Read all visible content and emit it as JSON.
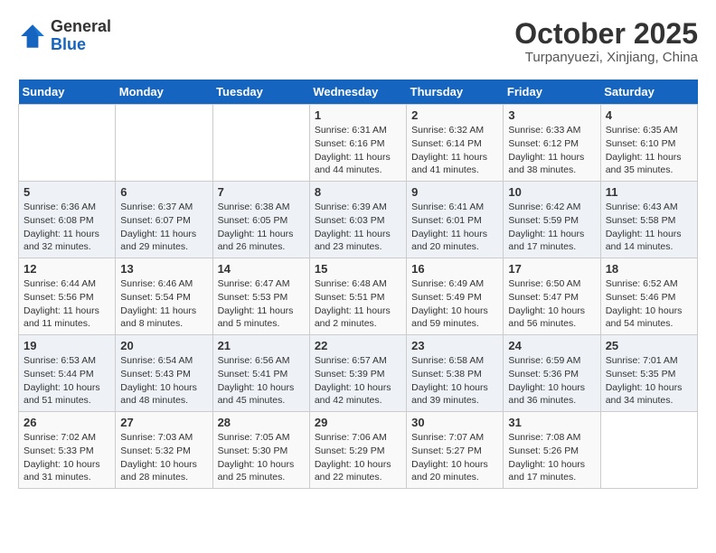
{
  "header": {
    "logo_line1": "General",
    "logo_line2": "Blue",
    "month": "October 2025",
    "location": "Turpanyuezi, Xinjiang, China"
  },
  "weekdays": [
    "Sunday",
    "Monday",
    "Tuesday",
    "Wednesday",
    "Thursday",
    "Friday",
    "Saturday"
  ],
  "weeks": [
    [
      {
        "day": "",
        "info": ""
      },
      {
        "day": "",
        "info": ""
      },
      {
        "day": "",
        "info": ""
      },
      {
        "day": "1",
        "info": "Sunrise: 6:31 AM\nSunset: 6:16 PM\nDaylight: 11 hours\nand 44 minutes."
      },
      {
        "day": "2",
        "info": "Sunrise: 6:32 AM\nSunset: 6:14 PM\nDaylight: 11 hours\nand 41 minutes."
      },
      {
        "day": "3",
        "info": "Sunrise: 6:33 AM\nSunset: 6:12 PM\nDaylight: 11 hours\nand 38 minutes."
      },
      {
        "day": "4",
        "info": "Sunrise: 6:35 AM\nSunset: 6:10 PM\nDaylight: 11 hours\nand 35 minutes."
      }
    ],
    [
      {
        "day": "5",
        "info": "Sunrise: 6:36 AM\nSunset: 6:08 PM\nDaylight: 11 hours\nand 32 minutes."
      },
      {
        "day": "6",
        "info": "Sunrise: 6:37 AM\nSunset: 6:07 PM\nDaylight: 11 hours\nand 29 minutes."
      },
      {
        "day": "7",
        "info": "Sunrise: 6:38 AM\nSunset: 6:05 PM\nDaylight: 11 hours\nand 26 minutes."
      },
      {
        "day": "8",
        "info": "Sunrise: 6:39 AM\nSunset: 6:03 PM\nDaylight: 11 hours\nand 23 minutes."
      },
      {
        "day": "9",
        "info": "Sunrise: 6:41 AM\nSunset: 6:01 PM\nDaylight: 11 hours\nand 20 minutes."
      },
      {
        "day": "10",
        "info": "Sunrise: 6:42 AM\nSunset: 5:59 PM\nDaylight: 11 hours\nand 17 minutes."
      },
      {
        "day": "11",
        "info": "Sunrise: 6:43 AM\nSunset: 5:58 PM\nDaylight: 11 hours\nand 14 minutes."
      }
    ],
    [
      {
        "day": "12",
        "info": "Sunrise: 6:44 AM\nSunset: 5:56 PM\nDaylight: 11 hours\nand 11 minutes."
      },
      {
        "day": "13",
        "info": "Sunrise: 6:46 AM\nSunset: 5:54 PM\nDaylight: 11 hours\nand 8 minutes."
      },
      {
        "day": "14",
        "info": "Sunrise: 6:47 AM\nSunset: 5:53 PM\nDaylight: 11 hours\nand 5 minutes."
      },
      {
        "day": "15",
        "info": "Sunrise: 6:48 AM\nSunset: 5:51 PM\nDaylight: 11 hours\nand 2 minutes."
      },
      {
        "day": "16",
        "info": "Sunrise: 6:49 AM\nSunset: 5:49 PM\nDaylight: 10 hours\nand 59 minutes."
      },
      {
        "day": "17",
        "info": "Sunrise: 6:50 AM\nSunset: 5:47 PM\nDaylight: 10 hours\nand 56 minutes."
      },
      {
        "day": "18",
        "info": "Sunrise: 6:52 AM\nSunset: 5:46 PM\nDaylight: 10 hours\nand 54 minutes."
      }
    ],
    [
      {
        "day": "19",
        "info": "Sunrise: 6:53 AM\nSunset: 5:44 PM\nDaylight: 10 hours\nand 51 minutes."
      },
      {
        "day": "20",
        "info": "Sunrise: 6:54 AM\nSunset: 5:43 PM\nDaylight: 10 hours\nand 48 minutes."
      },
      {
        "day": "21",
        "info": "Sunrise: 6:56 AM\nSunset: 5:41 PM\nDaylight: 10 hours\nand 45 minutes."
      },
      {
        "day": "22",
        "info": "Sunrise: 6:57 AM\nSunset: 5:39 PM\nDaylight: 10 hours\nand 42 minutes."
      },
      {
        "day": "23",
        "info": "Sunrise: 6:58 AM\nSunset: 5:38 PM\nDaylight: 10 hours\nand 39 minutes."
      },
      {
        "day": "24",
        "info": "Sunrise: 6:59 AM\nSunset: 5:36 PM\nDaylight: 10 hours\nand 36 minutes."
      },
      {
        "day": "25",
        "info": "Sunrise: 7:01 AM\nSunset: 5:35 PM\nDaylight: 10 hours\nand 34 minutes."
      }
    ],
    [
      {
        "day": "26",
        "info": "Sunrise: 7:02 AM\nSunset: 5:33 PM\nDaylight: 10 hours\nand 31 minutes."
      },
      {
        "day": "27",
        "info": "Sunrise: 7:03 AM\nSunset: 5:32 PM\nDaylight: 10 hours\nand 28 minutes."
      },
      {
        "day": "28",
        "info": "Sunrise: 7:05 AM\nSunset: 5:30 PM\nDaylight: 10 hours\nand 25 minutes."
      },
      {
        "day": "29",
        "info": "Sunrise: 7:06 AM\nSunset: 5:29 PM\nDaylight: 10 hours\nand 22 minutes."
      },
      {
        "day": "30",
        "info": "Sunrise: 7:07 AM\nSunset: 5:27 PM\nDaylight: 10 hours\nand 20 minutes."
      },
      {
        "day": "31",
        "info": "Sunrise: 7:08 AM\nSunset: 5:26 PM\nDaylight: 10 hours\nand 17 minutes."
      },
      {
        "day": "",
        "info": ""
      }
    ]
  ]
}
